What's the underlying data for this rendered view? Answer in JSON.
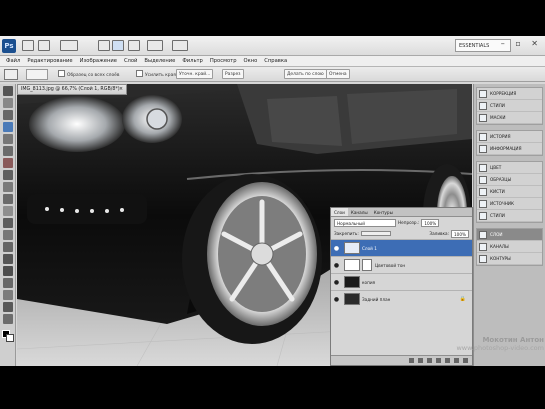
{
  "app": {
    "workspace": "ESSENTIALS",
    "window_controls": "– ▫ ✕"
  },
  "menus": [
    "Файл",
    "Редактирование",
    "Изображение",
    "Слой",
    "Выделение",
    "Фильтр",
    "Просмотр",
    "Окно",
    "Справка"
  ],
  "options_bar": {
    "check_all_layers": "Образец со всех слоёв",
    "check_enhance": "Усилить края",
    "refine_edge": "Уточн. край...",
    "btn_a": "Разрез",
    "btn_b": "Делать по слою",
    "btn_c": "Отмена"
  },
  "document": {
    "tab_title": "IMG_8113.jpg @ 66,7% (Слой 1, RGB/8*)",
    "tab_close": "×"
  },
  "dock": {
    "group1": [
      {
        "icon": "adjustments-icon",
        "label": "КОРРЕКЦИЯ"
      },
      {
        "icon": "styles-icon",
        "label": "СТИЛИ"
      },
      {
        "icon": "masks-icon",
        "label": "МАСКИ"
      }
    ],
    "group2": [
      {
        "icon": "history-icon",
        "label": "ИСТОРИЯ"
      },
      {
        "icon": "info-icon",
        "label": "ИНФОРМАЦИЯ"
      }
    ],
    "group3": [
      {
        "icon": "swatches-icon",
        "label": "ЦВЕТ"
      },
      {
        "icon": "swatch-grid-icon",
        "label": "ОБРАЗЦЫ"
      },
      {
        "icon": "brushes-icon",
        "label": "КИСТИ"
      },
      {
        "icon": "clone-icon",
        "label": "ИСТОЧНИК"
      },
      {
        "icon": "actions-icon",
        "label": "СТИЛИ"
      }
    ],
    "group4": [
      {
        "icon": "layers-icon",
        "label": "СЛОИ"
      },
      {
        "icon": "channels-icon",
        "label": "КАНАЛЫ"
      },
      {
        "icon": "paths-icon",
        "label": "КОНТУРЫ"
      }
    ],
    "active_label": "СЛОИ"
  },
  "layers_panel": {
    "tabs": [
      "Слои",
      "Каналы",
      "Контуры"
    ],
    "blend_mode": "Нормальный",
    "opacity_label": "Непрозр.:",
    "opacity_value": "100%",
    "lock_label": "Закрепить:",
    "fill_label": "Заливка:",
    "fill_value": "100%",
    "layers": [
      {
        "name": "Слой 1",
        "active": true,
        "thumb": "#e6ecf6",
        "mask": false
      },
      {
        "name": "Цветовой тон",
        "active": false,
        "thumb": "#ffffff",
        "mask": true
      },
      {
        "name": "копия",
        "active": false,
        "thumb": "#1a1a1a",
        "mask": false
      },
      {
        "name": "Задний план",
        "active": false,
        "thumb": "#2b2b2b",
        "mask": false,
        "lock": "🔒"
      }
    ]
  },
  "watermark": {
    "author": "Мокотин Антон",
    "site": "www.photoshop-video.com"
  }
}
